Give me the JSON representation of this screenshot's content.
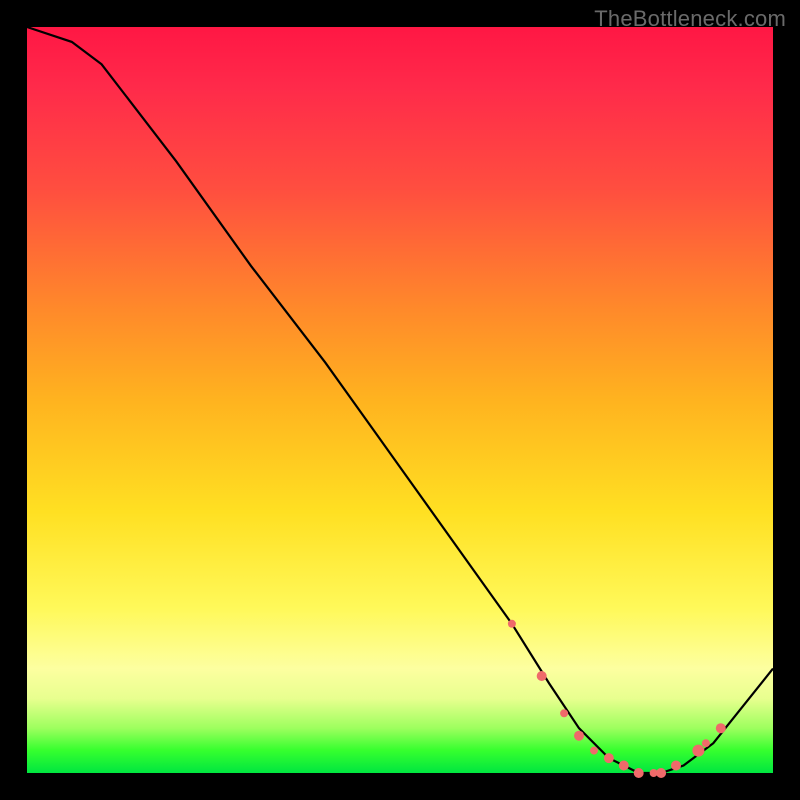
{
  "watermark": "TheBottleneck.com",
  "colors": {
    "gradient_top": "#ff1744",
    "gradient_mid1": "#ff8a2a",
    "gradient_mid2": "#ffe022",
    "gradient_mid3": "#fdffa0",
    "gradient_bottom": "#00e640",
    "curve": "#000000",
    "markers": "#ef6a6a",
    "frame": "#000000"
  },
  "chart_data": {
    "type": "line",
    "title": "",
    "xlabel": "",
    "ylabel": "",
    "xlim": [
      0,
      100
    ],
    "ylim": [
      0,
      100
    ],
    "grid": false,
    "legend": false,
    "series": [
      {
        "name": "curve",
        "x": [
          0,
          6,
          10,
          20,
          30,
          40,
          50,
          60,
          65,
          70,
          74,
          78,
          82,
          85,
          88,
          92,
          100
        ],
        "y": [
          100,
          98,
          95,
          82,
          68,
          55,
          41,
          27,
          20,
          12,
          6,
          2,
          0,
          0,
          1,
          4,
          14
        ]
      }
    ],
    "markers": {
      "name": "highlighted-points",
      "color": "#ef6a6a",
      "points": [
        {
          "x": 65,
          "y": 20,
          "r": 4
        },
        {
          "x": 69,
          "y": 13,
          "r": 5
        },
        {
          "x": 72,
          "y": 8,
          "r": 4
        },
        {
          "x": 74,
          "y": 5,
          "r": 5
        },
        {
          "x": 76,
          "y": 3,
          "r": 4
        },
        {
          "x": 78,
          "y": 2,
          "r": 5
        },
        {
          "x": 80,
          "y": 1,
          "r": 5
        },
        {
          "x": 82,
          "y": 0,
          "r": 5
        },
        {
          "x": 84,
          "y": 0,
          "r": 4
        },
        {
          "x": 85,
          "y": 0,
          "r": 5
        },
        {
          "x": 87,
          "y": 1,
          "r": 5
        },
        {
          "x": 90,
          "y": 3,
          "r": 6
        },
        {
          "x": 91,
          "y": 4,
          "r": 4
        },
        {
          "x": 93,
          "y": 6,
          "r": 5
        }
      ]
    }
  }
}
